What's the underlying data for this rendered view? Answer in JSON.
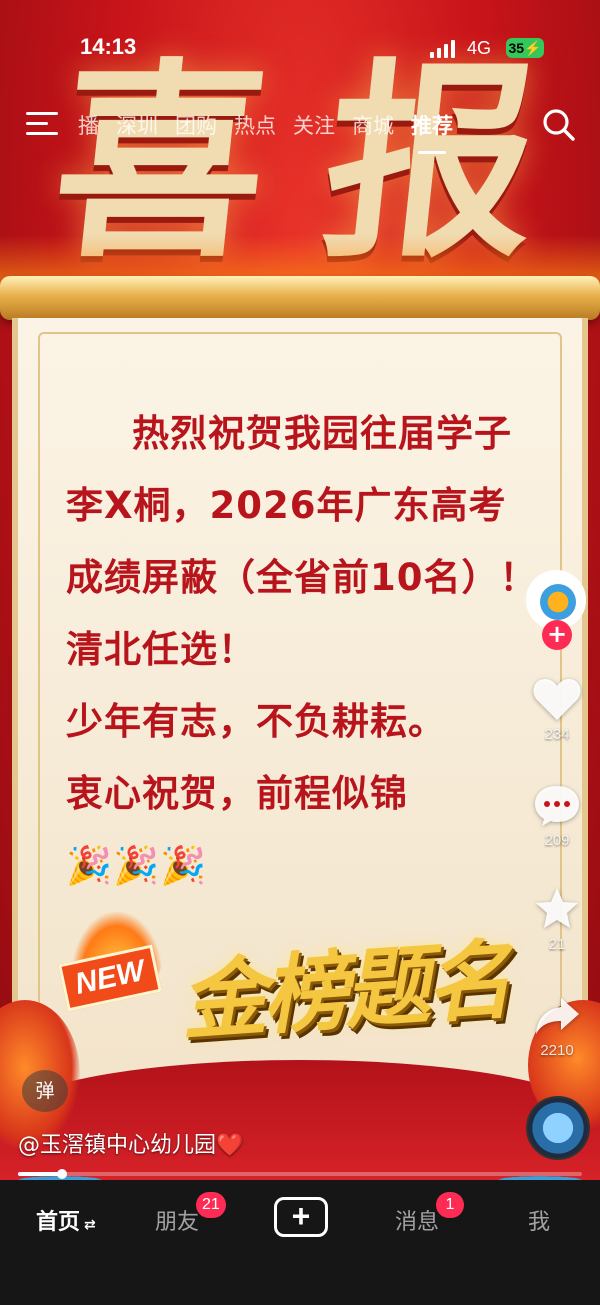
{
  "status_bar": {
    "time": "14:13",
    "network": "4G",
    "battery": "35"
  },
  "top_nav": {
    "tabs": [
      {
        "label": "播"
      },
      {
        "label": "深圳"
      },
      {
        "label": "团购"
      },
      {
        "label": "热点"
      },
      {
        "label": "关注"
      },
      {
        "label": "商城"
      },
      {
        "label": "推荐",
        "active": true
      }
    ],
    "menu_icon": "hamburger-icon",
    "search_icon": "search-icon"
  },
  "video": {
    "headline": [
      "喜",
      "报"
    ],
    "message_lines": [
      "热烈祝贺我园往届学子",
      "李X桐，2026年广东高考",
      "成绩屏蔽（全省前10名）！",
      "清北任选！",
      "少年有志，不负耕耘。",
      "衷心祝贺，前程似锦",
      "🎉🎉🎉"
    ],
    "new_tag": "NEW",
    "golden_title": "金榜题名"
  },
  "actions": {
    "follow": "+",
    "like_count": "234",
    "comment_count": "209",
    "favorite_count": "21",
    "share_count": "2210"
  },
  "video_info": {
    "danmu_label": "弹",
    "author": "@玉滘镇中心幼儿园",
    "author_suffix": "❤️",
    "progress": 0.08
  },
  "bottom_nav": {
    "home": "首页",
    "home_toggle": "⇄",
    "friends": "朋友",
    "friends_badge": "21",
    "create": "+",
    "messages": "消息",
    "messages_badge": "1",
    "me": "我"
  },
  "colors": {
    "accent": "#fe2c55",
    "message_text": "#b8141c",
    "battery": "#35c759"
  }
}
